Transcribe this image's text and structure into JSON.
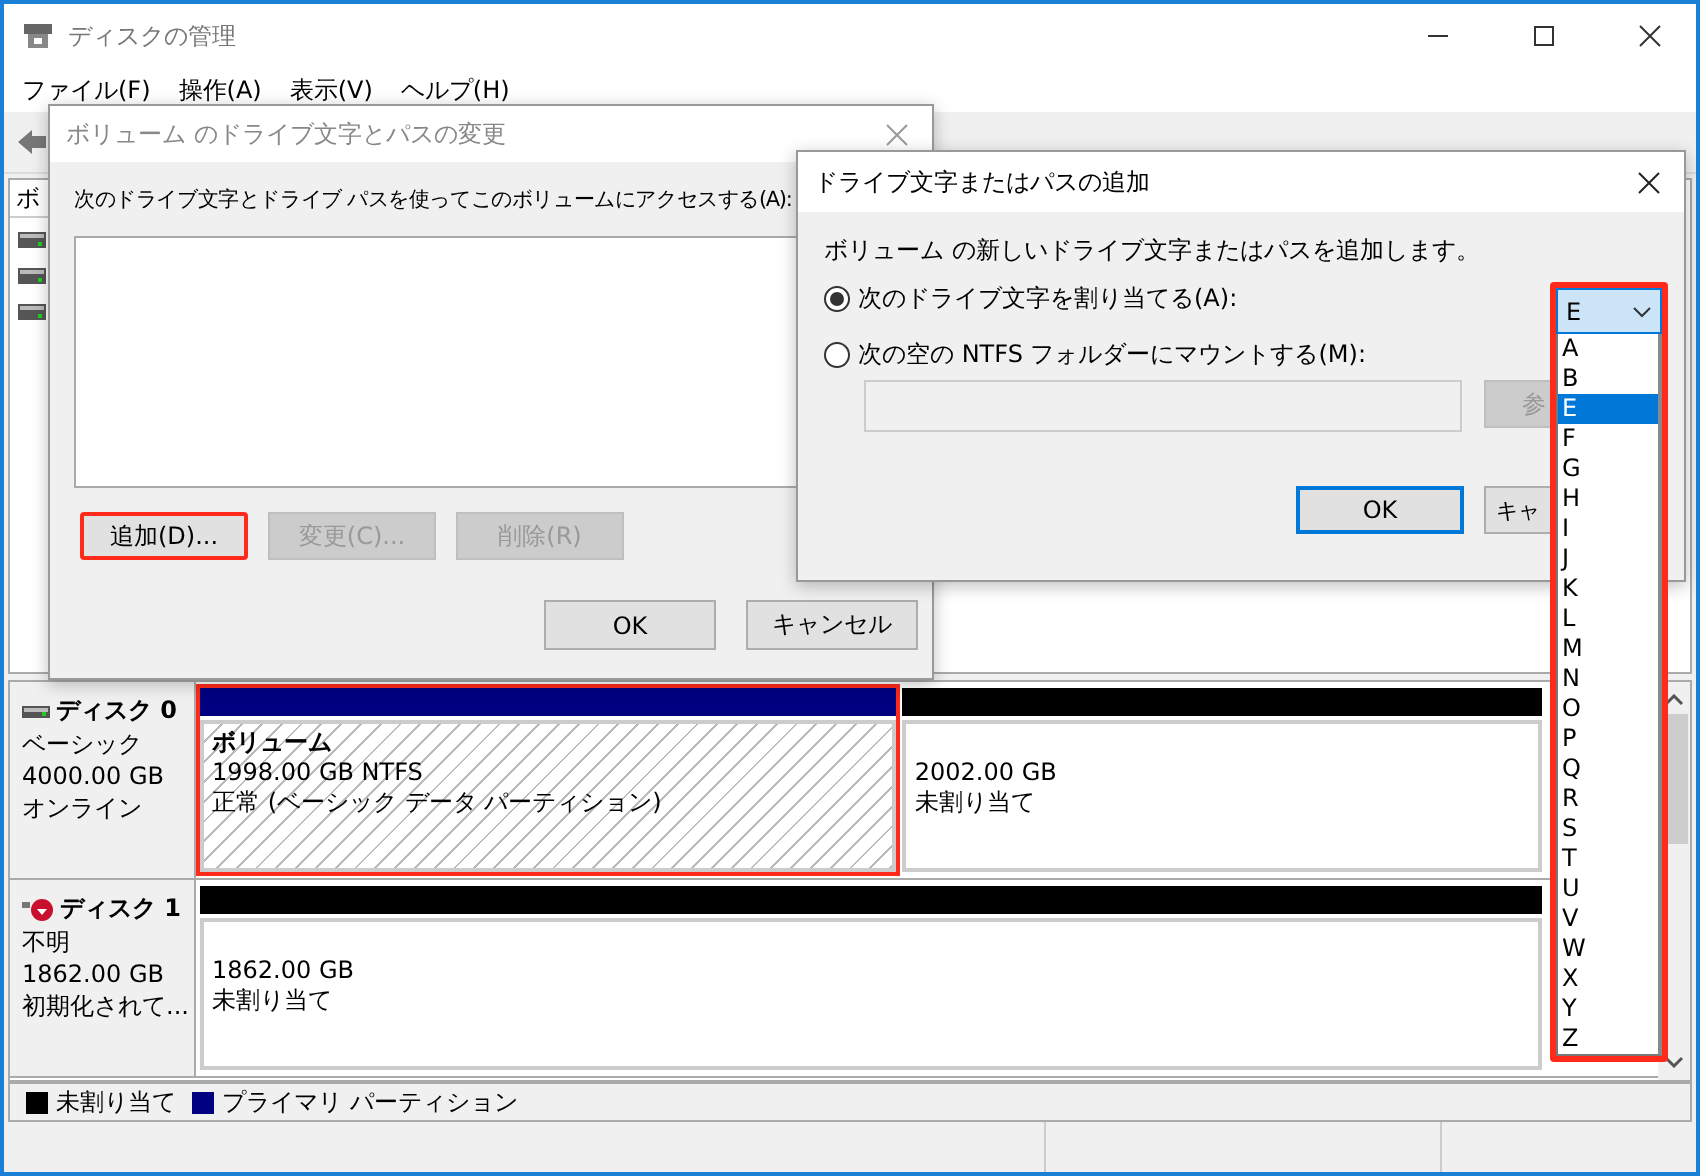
{
  "window": {
    "title": "ディスクの管理",
    "menu": [
      "ファイル(F)",
      "操作(A)",
      "表示(V)",
      "ヘルプ(H)"
    ]
  },
  "volume_list": {
    "header": "ボ"
  },
  "disks": [
    {
      "kind": "online",
      "name": "ディスク 0",
      "type": "ベーシック",
      "size": "4000.00 GB",
      "status": "オンライン",
      "partitions": [
        {
          "kind": "primary",
          "name": "ボリューム",
          "size": "1998.00 GB NTFS",
          "status": "正常 (ベーシック データ パーティション)",
          "highlighted": true
        },
        {
          "kind": "unallocated",
          "size": "2002.00 GB",
          "status": "未割り当て",
          "highlighted": false
        }
      ]
    },
    {
      "kind": "unknown",
      "name": "ディスク 1",
      "type": "不明",
      "size": "1862.00 GB",
      "status": "初期化されて...",
      "partitions": [
        {
          "kind": "unallocated",
          "size": "1862.00 GB",
          "status": "未割り当て",
          "highlighted": false
        }
      ]
    }
  ],
  "legend": [
    {
      "label": "未割り当て",
      "color": "#000000"
    },
    {
      "label": "プライマリ パーティション",
      "color": "#000080"
    }
  ],
  "dialog_1": {
    "title": "ボリューム のドライブ文字とパスの変更",
    "label": "次のドライブ文字とドライブ パスを使ってこのボリュームにアクセスする(A):",
    "buttons": [
      {
        "label": "追加(D)...",
        "disabled": false,
        "highlighted": true
      },
      {
        "label": "変更(C)...",
        "disabled": true,
        "highlighted": false
      },
      {
        "label": "削除(R)",
        "disabled": true,
        "highlighted": false
      }
    ],
    "footer_buttons": [
      {
        "label": "OK"
      },
      {
        "label": "キャンセル"
      }
    ]
  },
  "dialog_2": {
    "title": "ドライブ文字またはパスの追加",
    "description": "ボリューム の新しいドライブ文字またはパスを追加します。",
    "options": [
      {
        "label": "次のドライブ文字を割り当てる(A):",
        "selected": true
      },
      {
        "label": "次の空の NTFS フォルダーにマウントする(M):",
        "selected": false
      }
    ],
    "folder_field": {
      "disabled": true
    },
    "browse_button": {
      "label": "参",
      "disabled": true
    },
    "buttons": [
      {
        "label": "OK",
        "default": true
      },
      {
        "label": "キャ",
        "default": false
      }
    ],
    "drive_select": {
      "value": "E",
      "expanded": true,
      "highlighted": true,
      "options": [
        {
          "label": "A",
          "selected": false
        },
        {
          "label": "B",
          "selected": false
        },
        {
          "label": "E",
          "selected": true
        },
        {
          "label": "F",
          "selected": false
        },
        {
          "label": "G",
          "selected": false
        },
        {
          "label": "H",
          "selected": false
        },
        {
          "label": "I",
          "selected": false
        },
        {
          "label": "J",
          "selected": false
        },
        {
          "label": "K",
          "selected": false
        },
        {
          "label": "L",
          "selected": false
        },
        {
          "label": "M",
          "selected": false
        },
        {
          "label": "N",
          "selected": false
        },
        {
          "label": "O",
          "selected": false
        },
        {
          "label": "P",
          "selected": false
        },
        {
          "label": "Q",
          "selected": false
        },
        {
          "label": "R",
          "selected": false
        },
        {
          "label": "S",
          "selected": false
        },
        {
          "label": "T",
          "selected": false
        },
        {
          "label": "U",
          "selected": false
        },
        {
          "label": "V",
          "selected": false
        },
        {
          "label": "W",
          "selected": false
        },
        {
          "label": "X",
          "selected": false
        },
        {
          "label": "Y",
          "selected": false
        },
        {
          "label": "Z",
          "selected": false
        }
      ]
    }
  }
}
